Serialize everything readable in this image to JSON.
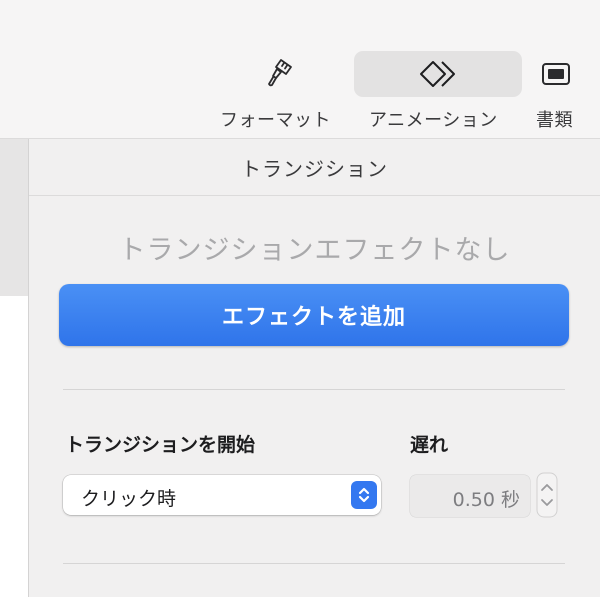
{
  "toolbar": {
    "buttons": [
      {
        "label": "フォーマット",
        "icon": "paintbrush-icon",
        "selected": false
      },
      {
        "label": "アニメーション",
        "icon": "animation-diamonds-icon",
        "selected": true
      },
      {
        "label": "書類",
        "icon": "document-icon",
        "selected": false
      }
    ]
  },
  "inspector": {
    "header": "トランジション",
    "empty_state": "トランジションエフェクトなし",
    "add_effect_button": "エフェクトを追加",
    "start_label": "トランジションを開始",
    "start_value": "クリック時",
    "delay_label": "遅れ",
    "delay_value": "0.50 秒"
  },
  "colors": {
    "accent": "#3478f0",
    "button_blue": "#3a82f2",
    "panel_bg": "#f1f0f0"
  }
}
